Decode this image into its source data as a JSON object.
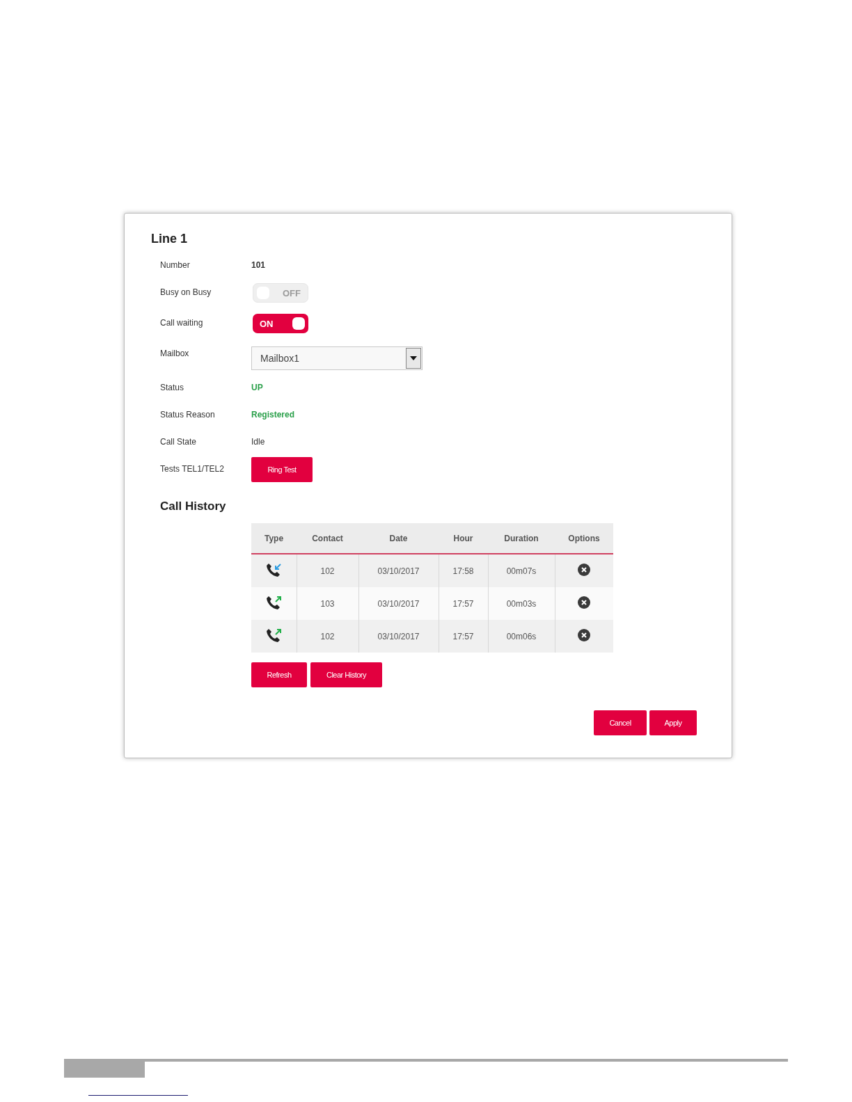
{
  "panel": {
    "title": "Line 1",
    "fields": [
      {
        "kind": "text",
        "label": "Number",
        "value": "101",
        "bold": true
      },
      {
        "kind": "toggle",
        "label": "Busy on Busy",
        "on": false,
        "state_text": "OFF"
      },
      {
        "kind": "toggle",
        "label": "Call waiting",
        "on": true,
        "state_text": "ON"
      },
      {
        "kind": "select",
        "label": "Mailbox",
        "value": "Mailbox1"
      },
      {
        "kind": "text",
        "label": "Status",
        "value": "UP",
        "bold": true,
        "color": "#2aa04a"
      },
      {
        "kind": "text",
        "label": "Status Reason",
        "value": "Registered",
        "bold": true,
        "color": "#2aa04a"
      },
      {
        "kind": "text",
        "label": "Call State",
        "value": "Idle",
        "bold": false
      },
      {
        "kind": "button",
        "label": "Tests TEL1/TEL2",
        "value": "Ring Test"
      }
    ],
    "call_history": {
      "title": "Call History",
      "columns": [
        "Type",
        "Contact",
        "Date",
        "Hour",
        "Duration",
        "Options"
      ],
      "rows": [
        {
          "kind": "incoming",
          "contact": "102",
          "date": "03/10/2017",
          "hour": "17:58",
          "duration": "00m07s"
        },
        {
          "kind": "outgoing",
          "contact": "103",
          "date": "03/10/2017",
          "hour": "17:57",
          "duration": "00m03s"
        },
        {
          "kind": "outgoing",
          "contact": "102",
          "date": "03/10/2017",
          "hour": "17:57",
          "duration": "00m06s"
        }
      ],
      "buttons": [
        "Refresh",
        "Clear History"
      ]
    },
    "buttons": [
      "Cancel",
      "Apply"
    ]
  }
}
